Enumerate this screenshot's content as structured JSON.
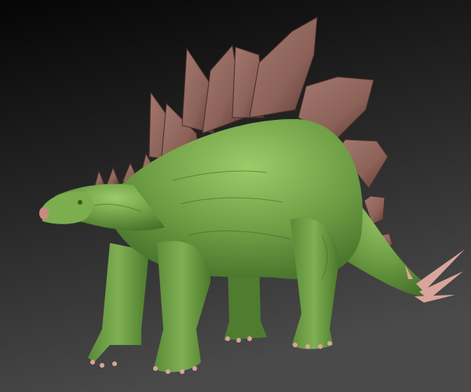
{
  "scene": {
    "subject": "stegosaurus",
    "colors": {
      "background_top": "#050505",
      "background_bottom": "#4a4a4a",
      "skin": "#6f9f45",
      "skin_shadow": "#3f6a25",
      "skin_highlight": "#9ccb6a",
      "plate": "#8c6259",
      "plate_shadow": "#5a3a34",
      "claw": "#d9a59a"
    }
  }
}
